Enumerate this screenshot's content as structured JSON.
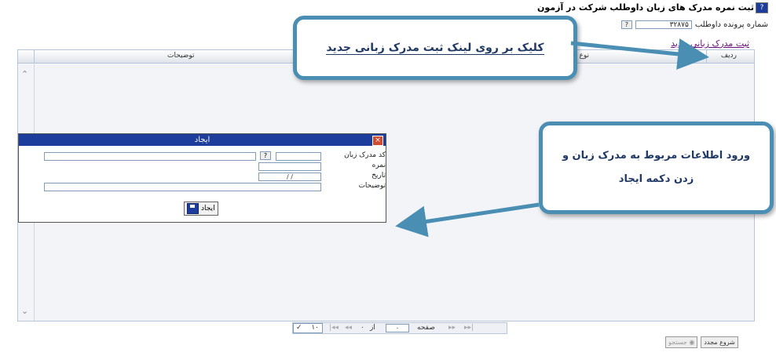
{
  "header": {
    "title": "ثبت نمره مدرک های زبان داوطلب شرکت در آزمون",
    "file_no_label": "شماره پرونده داوطلب",
    "file_no_value": "۳۲۸۷۵",
    "lookup_label": "?"
  },
  "new_link": "ثبت مدرک زبانی جدید",
  "grid": {
    "columns": [
      "ردیف",
      "نوع",
      "توضیحات"
    ]
  },
  "pager": {
    "per_page": "۱۰",
    "of_label": "از",
    "total_pages": "۰",
    "page_label": "صفحه",
    "page_value": "۰"
  },
  "bottom": {
    "restart_label": "شروع مجدد",
    "search_label": "جستجو"
  },
  "dialog": {
    "title": "ایجاد",
    "close": "×",
    "fields": {
      "lang_code_label": "کد مدرک زبان",
      "score_label": "نمره",
      "date_label": "تاریخ",
      "date_value": "/ /",
      "desc_label": "توضیحات"
    },
    "create_label": "ایجاد"
  },
  "callouts": {
    "click_link": "کلیک بر روی لینک ثبت مدرک زبانی جدید",
    "enter_info": "ورود اطلاعات مربوط به مدرک زبان و زدن دکمه ایجاد"
  },
  "colors": {
    "title_bar": "#1c3d9c",
    "callout_border": "#4a8fb3",
    "callout_text": "#1f3864",
    "link": "#6a0d7a"
  }
}
